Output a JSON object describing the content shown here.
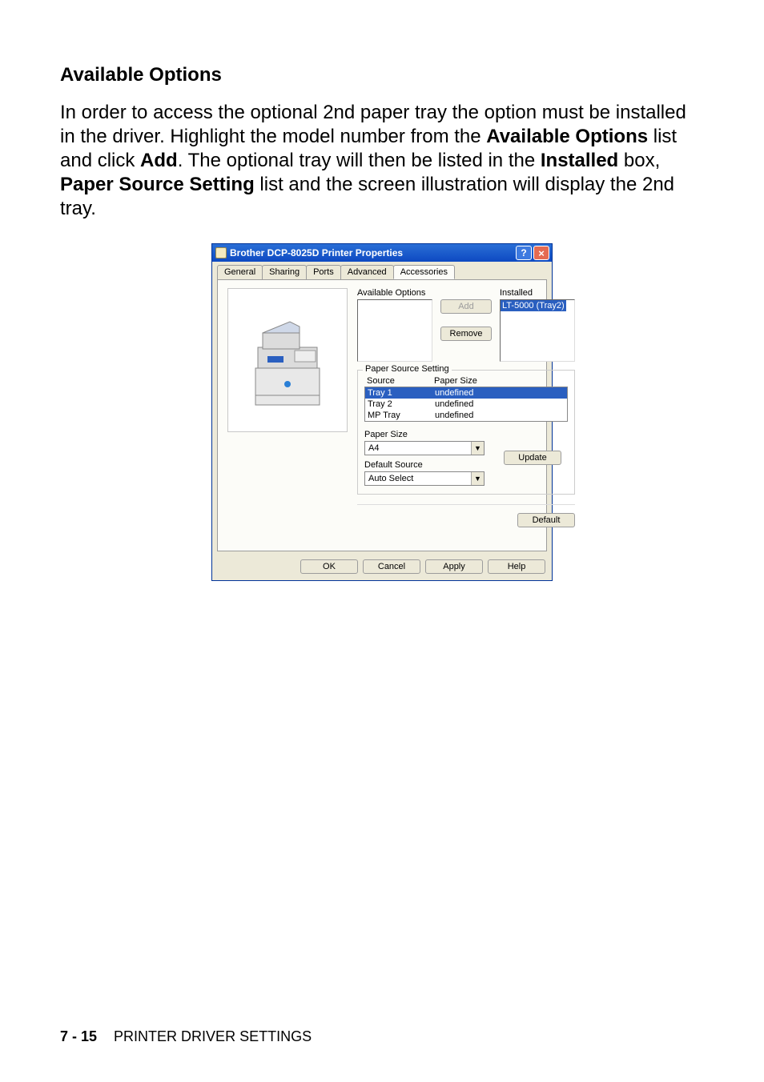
{
  "page": {
    "heading": "Available Options",
    "body_parts": [
      "In order to access the optional 2nd paper tray the option must be installed in the driver. Highlight the model number from the ",
      "Available Options",
      " list and click ",
      "Add",
      ". The optional tray will then be listed in the ",
      "Installed",
      " box, ",
      "Paper Source Setting",
      " list and the screen illustration will display the 2nd tray."
    ]
  },
  "dialog": {
    "title": "Brother DCP-8025D Printer Properties",
    "tabs": [
      "General",
      "Sharing",
      "Ports",
      "Advanced",
      "Accessories"
    ],
    "active_tab_index": 4,
    "available_options_label": "Available Options",
    "installed_label": "Installed",
    "installed_items": [
      "LT-5000 (Tray2)"
    ],
    "buttons": {
      "add": "Add",
      "remove": "Remove",
      "update": "Update",
      "default": "Default",
      "ok": "OK",
      "cancel": "Cancel",
      "apply": "Apply",
      "help": "Help"
    },
    "paper_source_setting": {
      "title": "Paper Source Setting",
      "col_source": "Source",
      "col_size": "Paper Size",
      "rows": [
        {
          "source": "Tray 1",
          "size": "undefined",
          "selected": true
        },
        {
          "source": "Tray 2",
          "size": "undefined",
          "selected": false
        },
        {
          "source": "MP Tray",
          "size": "undefined",
          "selected": false
        }
      ],
      "paper_size_label": "Paper Size",
      "paper_size_value": "A4",
      "default_source_label": "Default Source",
      "default_source_value": "Auto Select"
    }
  },
  "footer": {
    "page_num": "7 - 15",
    "section": "PRINTER DRIVER SETTINGS"
  }
}
